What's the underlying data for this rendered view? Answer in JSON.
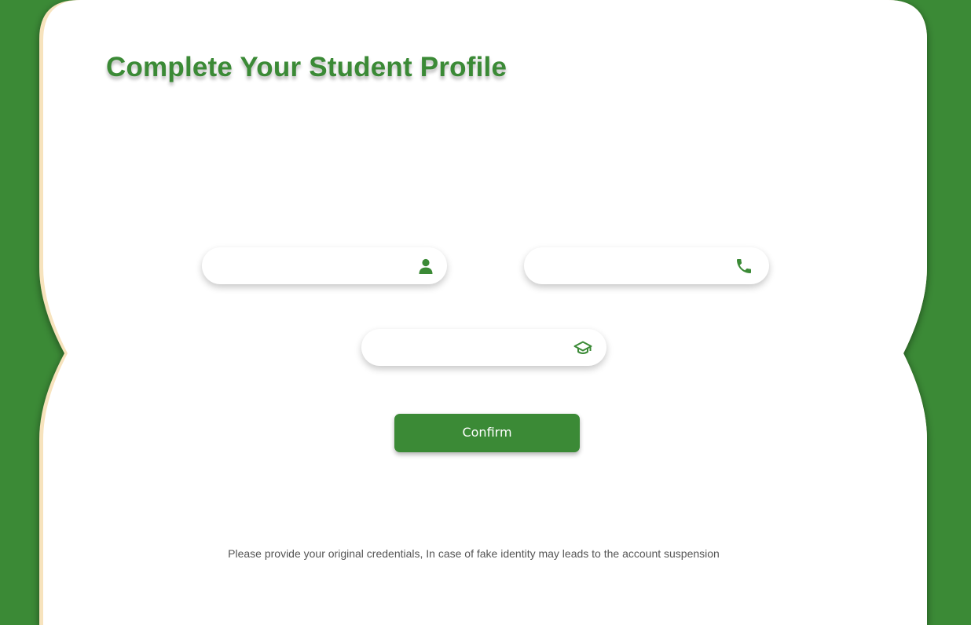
{
  "theme": {
    "accent": "#3b8a36",
    "card": "#ffffff",
    "border_trim": "#f7e3bd"
  },
  "page": {
    "title": "Complete Your Student Profile"
  },
  "form": {
    "fields": [
      {
        "name": "name",
        "icon": "person-icon",
        "value": "",
        "placeholder": ""
      },
      {
        "name": "phone",
        "icon": "phone-icon",
        "value": "",
        "placeholder": ""
      },
      {
        "name": "education",
        "icon": "graduation-cap-icon",
        "value": "",
        "placeholder": ""
      }
    ],
    "confirm_label": "Confirm"
  },
  "notice": "Please provide your original credentials, In case of fake identity may leads to the account suspension"
}
